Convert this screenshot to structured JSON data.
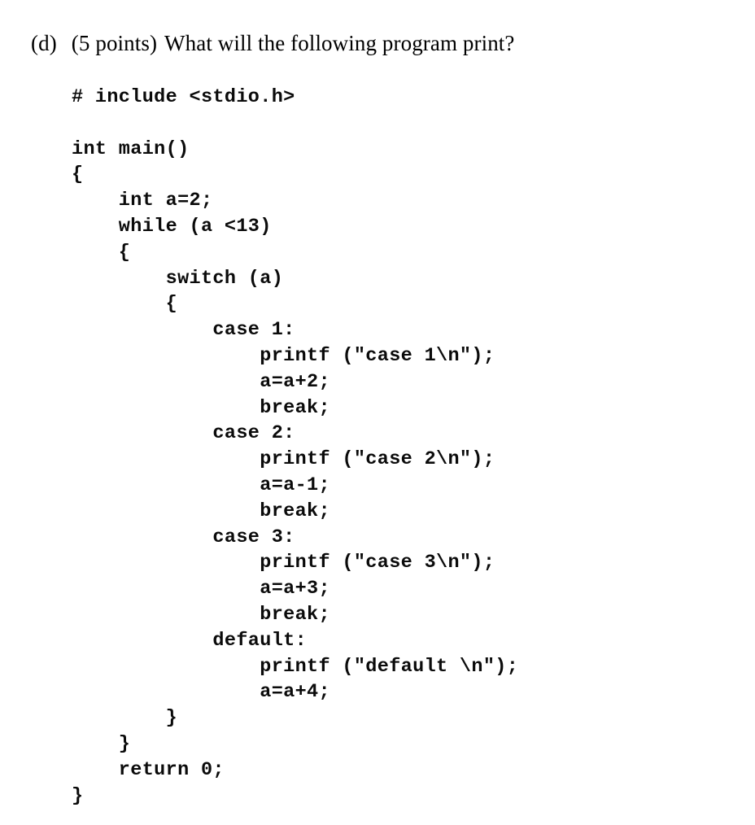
{
  "question": {
    "label": "(d)",
    "points": "(5 points)",
    "text": "What will the following program print?"
  },
  "code": {
    "language": "c",
    "lines": [
      "# include <stdio.h>",
      "",
      "int main()",
      "{",
      "    int a=2;",
      "    while (a <13)",
      "    {",
      "        switch (a)",
      "        {",
      "            case 1:",
      "                printf (\"case 1\\n\");",
      "                a=a+2;",
      "                break;",
      "            case 2:",
      "                printf (\"case 2\\n\");",
      "                a=a-1;",
      "                break;",
      "            case 3:",
      "                printf (\"case 3\\n\");",
      "                a=a+3;",
      "                break;",
      "            default:",
      "                printf (\"default \\n\");",
      "                a=a+4;",
      "        }",
      "    }",
      "    return 0;",
      "}"
    ]
  },
  "colors": {
    "background": "#ffffff",
    "text": "#000000",
    "code_text": "#0b0b0b"
  }
}
